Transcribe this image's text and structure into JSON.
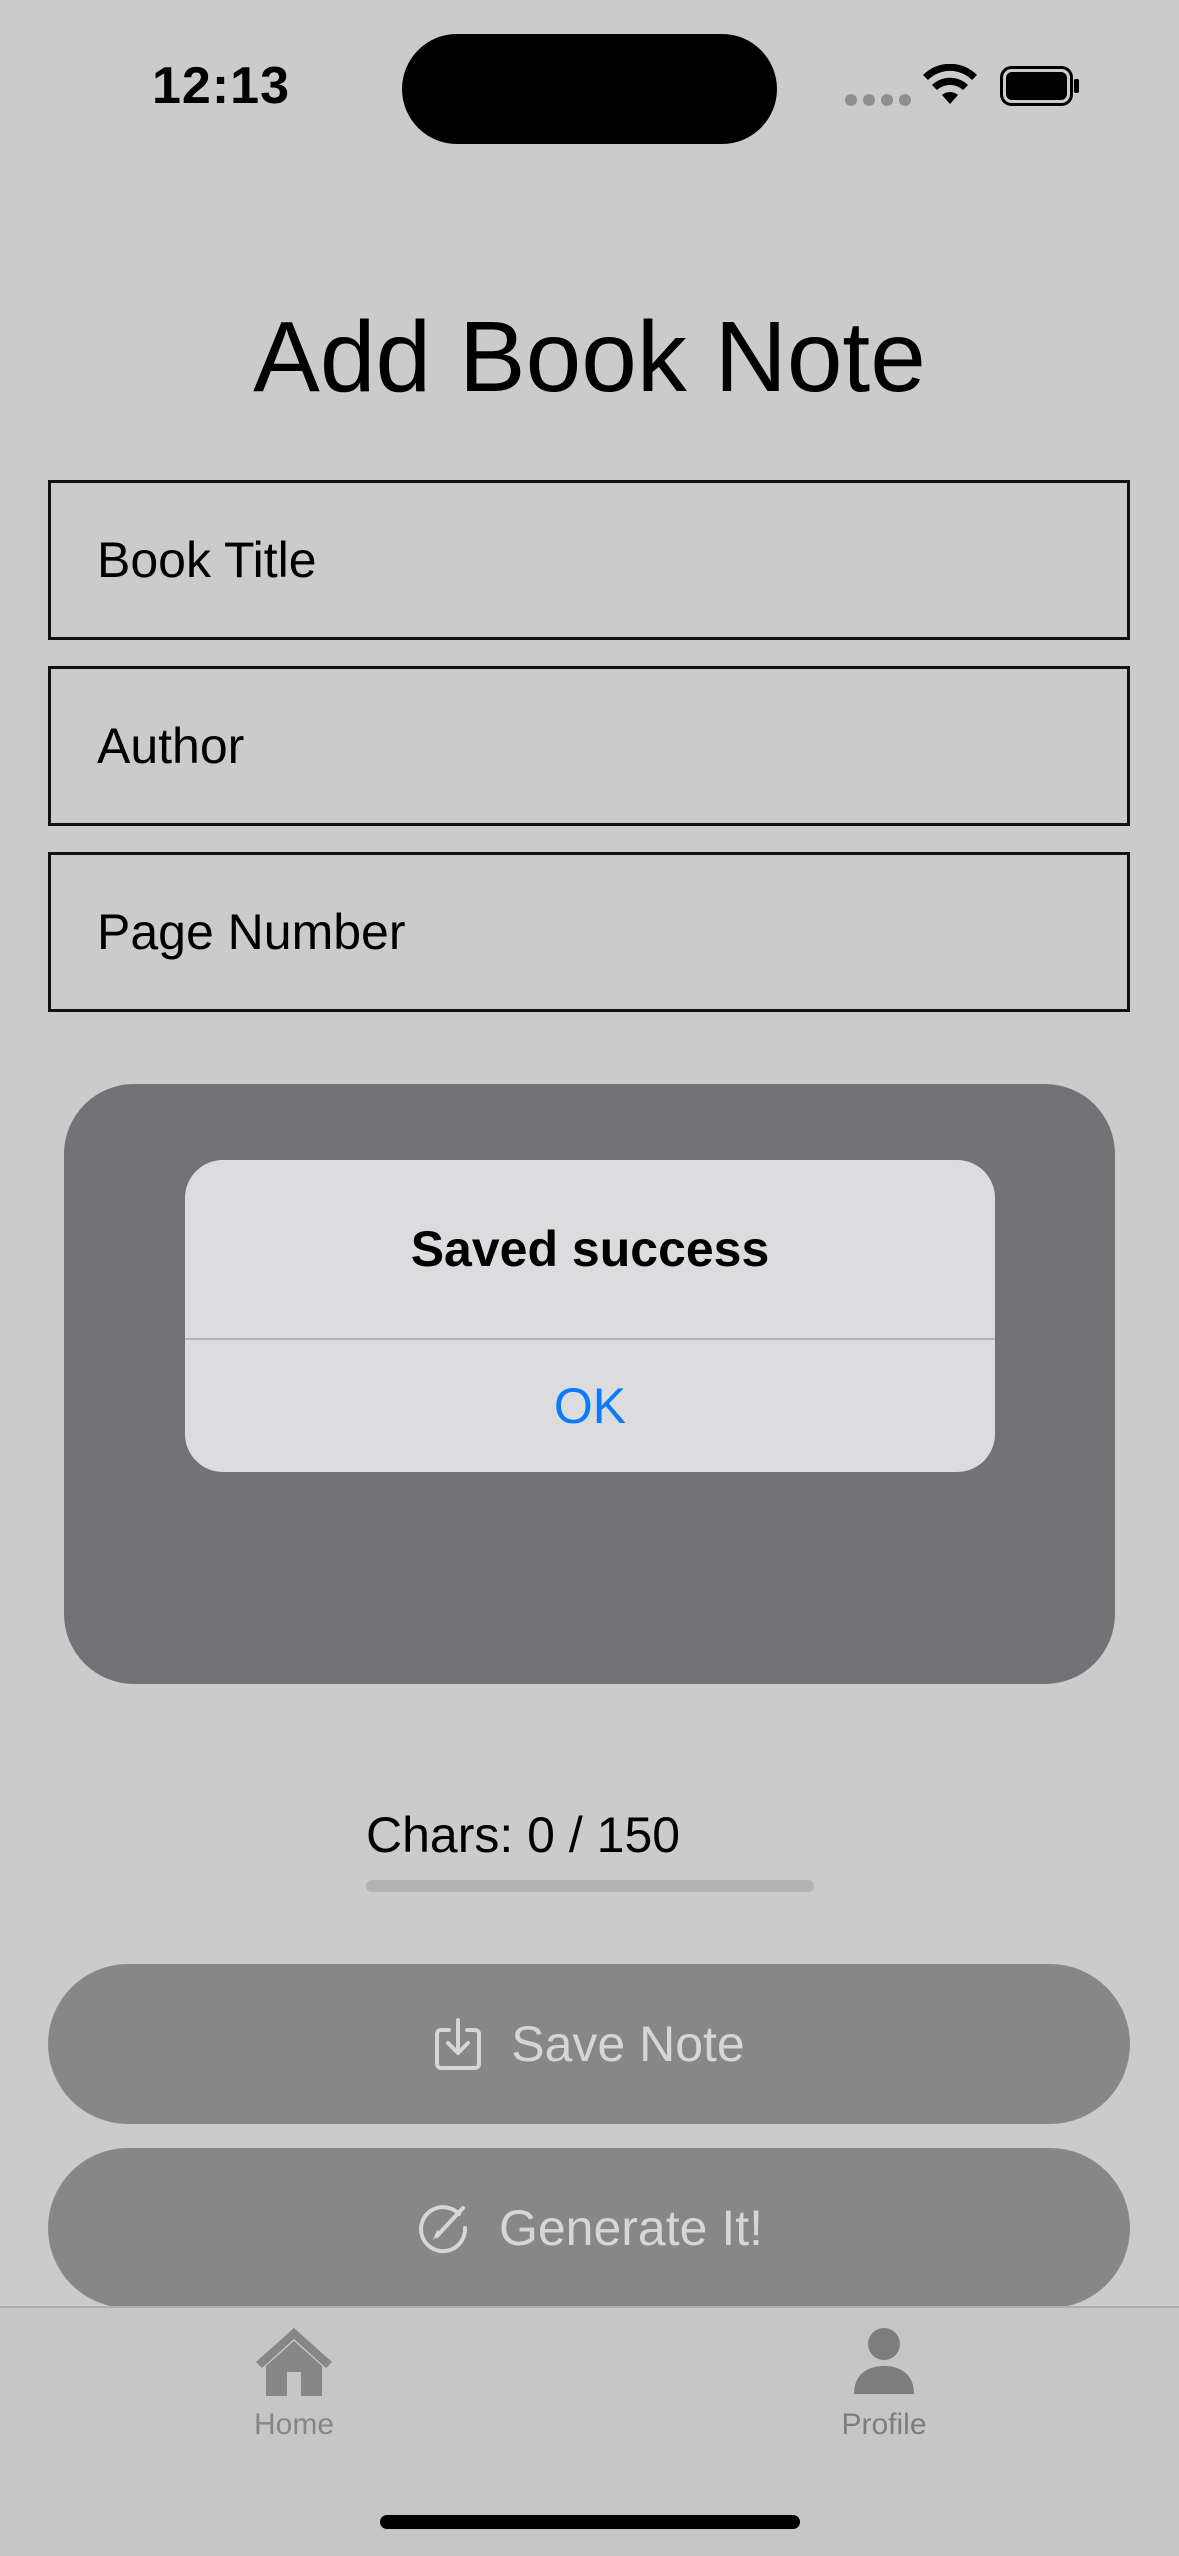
{
  "status_bar": {
    "time": "12:13",
    "wifi_icon": "wifi-icon",
    "battery_icon": "battery-icon"
  },
  "page": {
    "title": "Add Book Note"
  },
  "form": {
    "book_title_placeholder": "Book Title",
    "author_placeholder": "Author",
    "page_number_placeholder": "Page Number"
  },
  "alert": {
    "title": "Saved success",
    "ok_label": "OK"
  },
  "char_counter": {
    "text": "Chars: 0 / 150",
    "current": 0,
    "max": 150
  },
  "buttons": {
    "save_label": "Save Note",
    "save_icon": "save-download-icon",
    "generate_label": "Generate It!",
    "generate_icon": "pencil-circle-icon"
  },
  "tab_bar": {
    "items": [
      {
        "label": "Home",
        "icon": "house-icon"
      },
      {
        "label": "Profile",
        "icon": "person-icon"
      }
    ]
  },
  "colors": {
    "background": "#cbcbcb",
    "alert_accent": "#0a7aff",
    "disabled_button": "#878787"
  }
}
